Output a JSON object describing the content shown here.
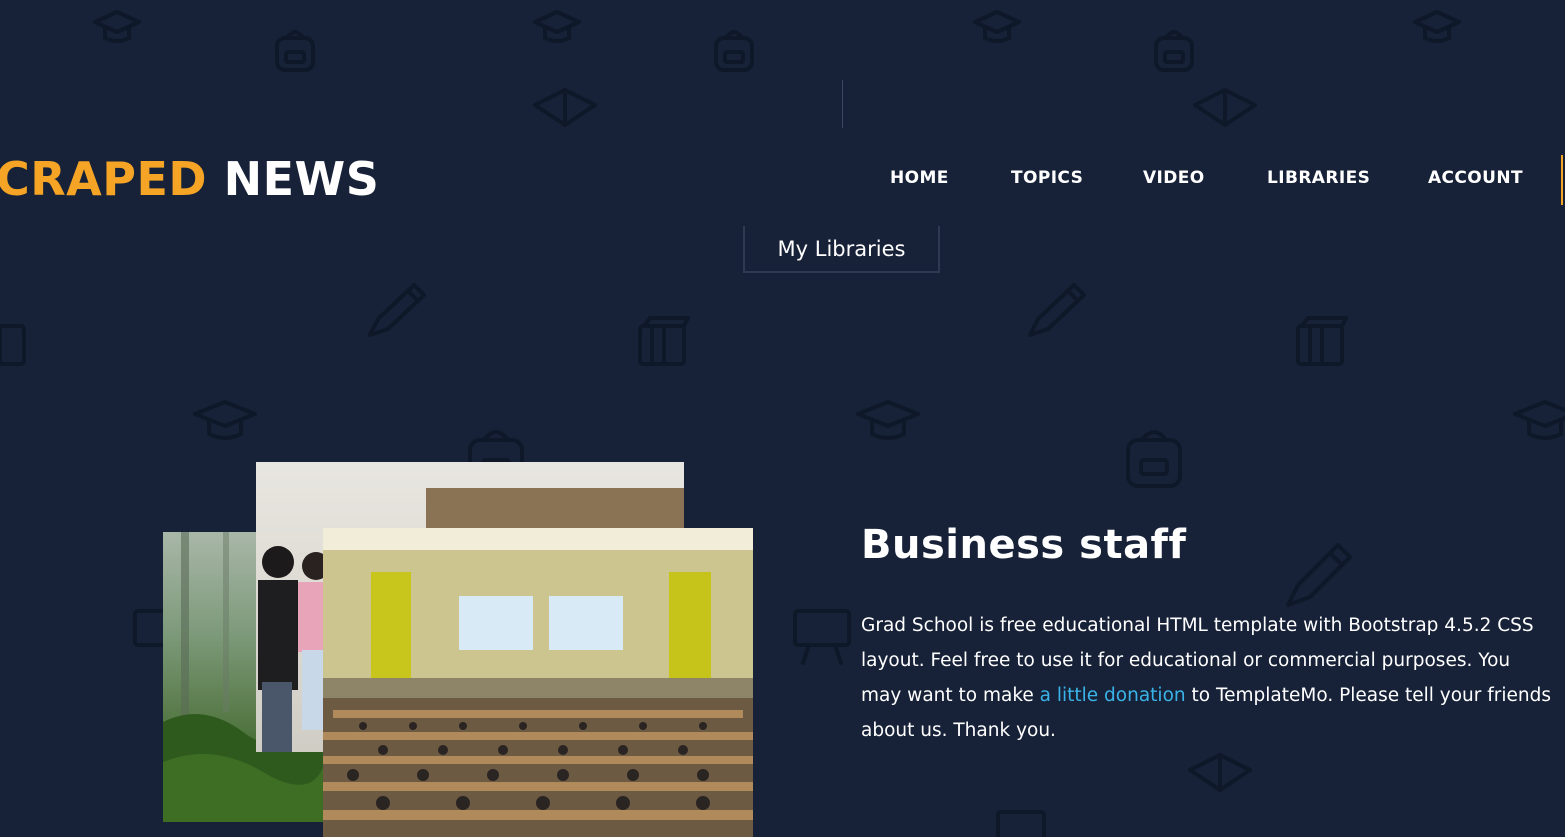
{
  "logo": {
    "accent": "CRAPED",
    "main": "NEWS"
  },
  "nav": {
    "items": [
      {
        "label": "HOME"
      },
      {
        "label": "TOPICS"
      },
      {
        "label": "VIDEO"
      },
      {
        "label": "LIBRARIES"
      },
      {
        "label": "ACCOUNT"
      }
    ]
  },
  "dropdown": {
    "item": "My Libraries"
  },
  "article": {
    "title": "Business staff",
    "text_before": "Grad School is free educational HTML template with Bootstrap 4.5.2 CSS layout. Feel free to use it for educational or commercial purposes. You may want to make ",
    "link": "a little donation",
    "text_after": " to TemplateMo. Please tell your friends about us. Thank you."
  },
  "images": [
    {
      "name": "forest-photo",
      "icon": "forest-image"
    },
    {
      "name": "students-photo",
      "icon": "students-image"
    },
    {
      "name": "auditorium-photo",
      "icon": "lecture-hall-image"
    }
  ],
  "colors": {
    "background": "#172238",
    "accent": "#f5a425",
    "link": "#3ab4e8",
    "text": "#ffffff"
  }
}
